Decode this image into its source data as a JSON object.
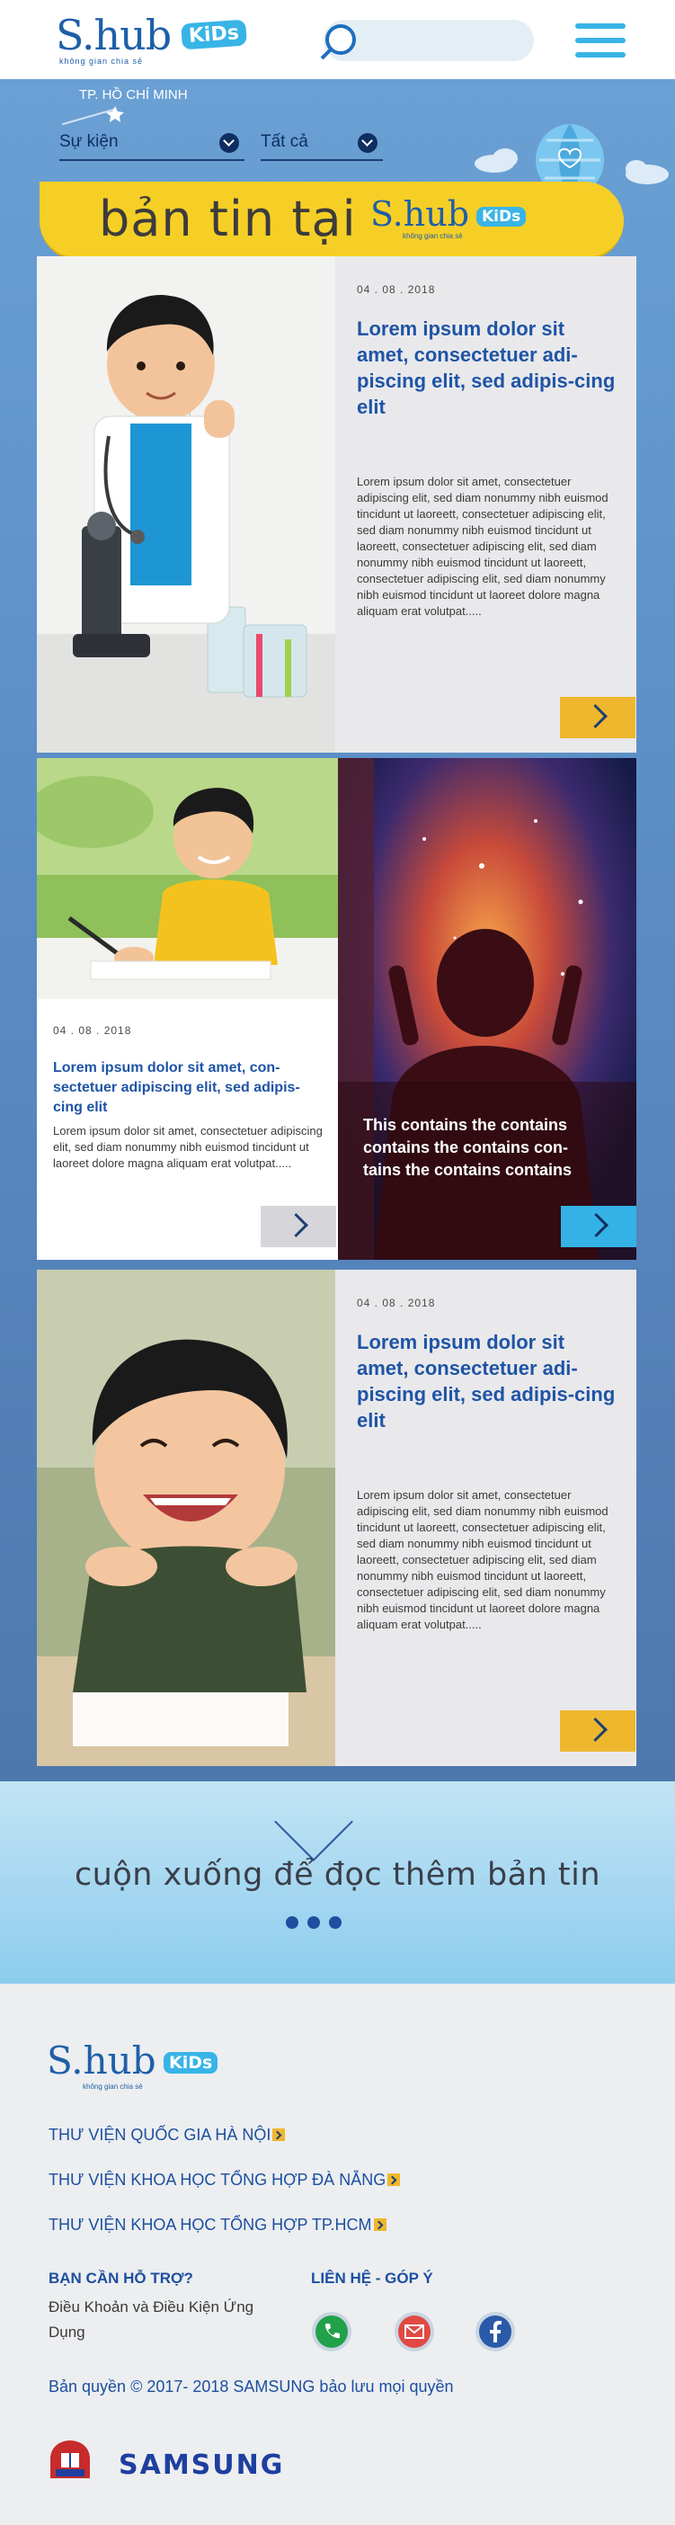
{
  "header": {
    "logo_main": "S.hub",
    "logo_kids": "KiDs",
    "logo_sub": "không gian chia sẻ",
    "search_placeholder": ""
  },
  "filters": {
    "city": "TP. HỒ CHÍ MINH",
    "event_label": "Sự kiện",
    "all_label": "Tất cả"
  },
  "banner": {
    "text": "bản tin tại",
    "logo_main": "S.hub",
    "logo_kids": "KiDs",
    "logo_sub": "không gian chia sẻ"
  },
  "cards": [
    {
      "date": "04 . 08 . 2018",
      "title": "Lorem ipsum dolor sit amet, consectetuer adi-piscing elit, sed adipis-cing elit",
      "body": "Lorem ipsum dolor sit amet, consectetuer adipiscing elit, sed diam nonummy nibh euismod tincidunt ut laoreett, consectetuer adipiscing elit, sed diam nonummy nibh euismod tincidunt ut laoreett, consectetuer adipiscing elit, sed diam nonummy nibh euismod tincidunt ut laoreett, consectetuer adipiscing elit, sed diam nonummy nibh euismod tincidunt ut laoreet dolore magna aliquam erat volutpat....."
    },
    {
      "date": "04 . 08 . 2018",
      "title": "Lorem ipsum dolor sit amet, con-sectetuer adipiscing elit, sed adipis-cing elit",
      "body": "Lorem ipsum dolor sit amet, consectetuer adipiscing elit, sed diam nonummy nibh euismod tincidunt ut laoreet dolore magna aliquam erat volutpat....."
    },
    {
      "overlay": "This contains the contains contains the contains con-tains the contains contains"
    },
    {
      "date": "04 . 08 . 2018",
      "title": "Lorem ipsum dolor sit amet, consectetuer adi-piscing elit, sed adipis-cing elit",
      "body": "Lorem ipsum dolor sit amet, consectetuer adipiscing elit, sed diam nonummy nibh euismod tincidunt ut laoreett, consectetuer adipiscing elit, sed diam nonummy nibh euismod tincidunt ut laoreett, consectetuer adipiscing elit, sed diam nonummy nibh euismod tincidunt ut laoreett, consectetuer adipiscing elit, sed diam nonummy nibh euismod tincidunt ut laoreet dolore magna aliquam erat volutpat....."
    }
  ],
  "more": {
    "text": "cuộn xuống để đọc thêm bản tin"
  },
  "footer": {
    "logo_main": "S.hub",
    "logo_kids": "KiDs",
    "logo_sub": "không gian chia sẻ",
    "libraries": [
      "THƯ VIỆN QUỐC GIA HÀ NỘI",
      "THƯ VIỆN KHOA HỌC TỔNG HỢP ĐÀ NẴNG",
      "THƯ VIỆN KHOA HỌC TỔNG HỢP TP.HCM"
    ],
    "help_heading": "BẠN CẦN HỖ TRỢ?",
    "help_links": "Điều Khoản và Điều Kiện Ứng Dụng",
    "contact_heading": "LIÊN HỆ  - GÓP Ý",
    "copyright": "Bản quyền © 2017- 2018 SAMSUNG bảo lưu mọi quyền",
    "samsung": "SAMSUNG"
  },
  "colors": {
    "brand_blue": "#1f5fa8",
    "accent_yellow": "#efb72d",
    "accent_cyan": "#34b2e6",
    "title_blue": "#1f54a6"
  }
}
